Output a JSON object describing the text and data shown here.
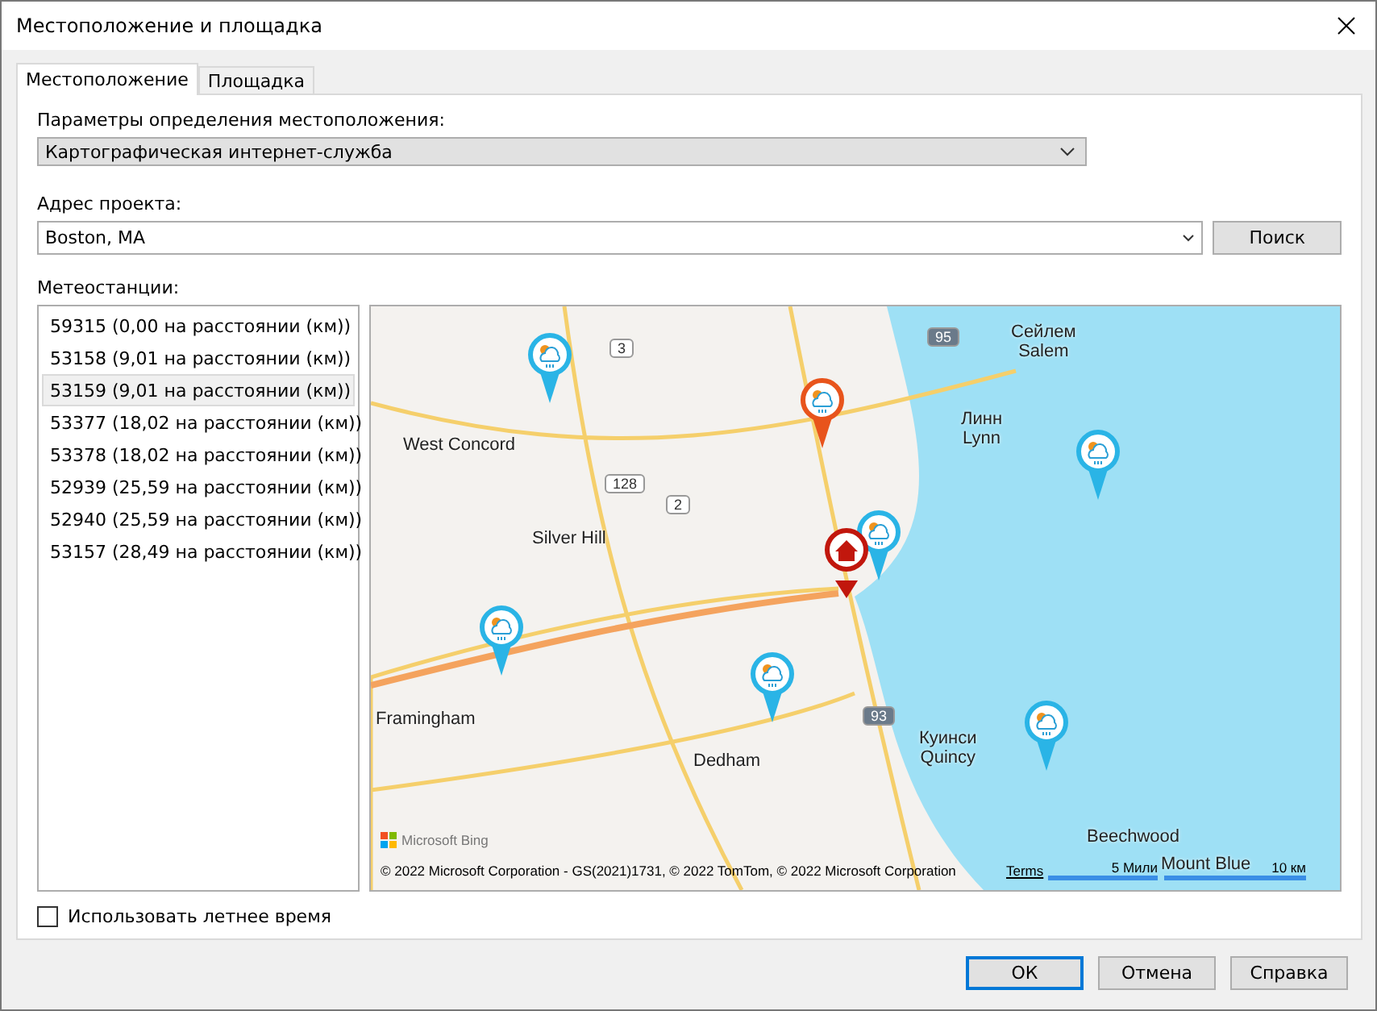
{
  "window": {
    "title": "Местоположение и площадка"
  },
  "tabs": [
    {
      "label": "Местоположение",
      "selected": true
    },
    {
      "label": "Площадка",
      "selected": false
    }
  ],
  "location_method": {
    "label": "Параметры определения местоположения:",
    "value": "Картографическая интернет-служба"
  },
  "address": {
    "label": "Адрес проекта:",
    "value": "Boston, MA",
    "button": "Поиск"
  },
  "stations": {
    "label": "Метеостанции:",
    "items": [
      {
        "text": "59315 (0,00 на расстоянии (км))",
        "selected": false
      },
      {
        "text": "53158 (9,01 на расстоянии (км))",
        "selected": false
      },
      {
        "text": "53159 (9,01 на расстоянии (км))",
        "selected": true
      },
      {
        "text": "53377 (18,02 на расстоянии (км))",
        "selected": false
      },
      {
        "text": "53378 (18,02 на расстоянии (км))",
        "selected": false
      },
      {
        "text": "52939 (25,59 на расстоянии (км))",
        "selected": false
      },
      {
        "text": "52940 (25,59 на расстоянии (км))",
        "selected": false
      },
      {
        "text": "53157 (28,49 на расстоянии (км))",
        "selected": false
      }
    ]
  },
  "map": {
    "places": [
      [
        "Сейлем",
        "Salem"
      ],
      [
        "Линн",
        "Lynn"
      ],
      [
        "West Concord"
      ],
      [
        "Silver Hill"
      ],
      [
        "Framingham"
      ],
      [
        "Dedham"
      ],
      [
        "Куинси",
        "Quincy"
      ],
      [
        "Beechwood"
      ],
      [
        "Mount Blue"
      ]
    ],
    "roads": [
      "3",
      "128",
      "2",
      "95",
      "93"
    ],
    "pins": [
      {
        "kind": "station",
        "color": "#2ab4e6"
      },
      {
        "kind": "station",
        "color": "#e8541c"
      },
      {
        "kind": "station",
        "color": "#2ab4e6"
      },
      {
        "kind": "station",
        "color": "#2ab4e6"
      },
      {
        "kind": "home"
      },
      {
        "kind": "station",
        "color": "#2ab4e6"
      },
      {
        "kind": "station",
        "color": "#2ab4e6"
      },
      {
        "kind": "station",
        "color": "#2ab4e6"
      }
    ],
    "logo": "Microsoft Bing",
    "attribution": "© 2022 Microsoft Corporation - GS(2021)1731, © 2022 TomTom, © 2022 Microsoft Corporation",
    "terms": "Terms",
    "scale_miles": "5 Мили",
    "scale_km": "10 км"
  },
  "daylight_saving": {
    "label": "Использовать летнее время",
    "checked": false
  },
  "buttons": [
    "ОК",
    "Отмена",
    "Справка"
  ]
}
